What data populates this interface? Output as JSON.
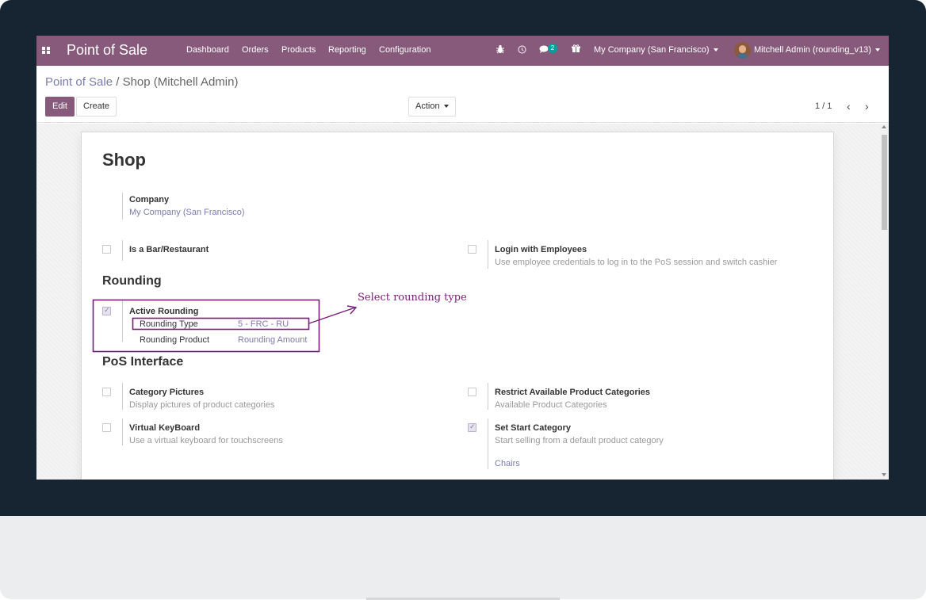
{
  "colors": {
    "brand": "#875a7b",
    "link": "#7c7bad",
    "annotation": "#7a1a7a",
    "badge": "#00a09d",
    "bezel": "#172431"
  },
  "navbar": {
    "app_name": "Point of Sale",
    "menu": [
      "Dashboard",
      "Orders",
      "Products",
      "Reporting",
      "Configuration"
    ],
    "icons": [
      "apps-icon",
      "bug-icon",
      "clock-icon",
      "chat-icon",
      "gift-icon"
    ],
    "messages_count": "2",
    "company": "My Company (San Francisco)",
    "user": "Mitchell Admin (rounding_v13)"
  },
  "breadcrumb": {
    "parent": "Point of Sale",
    "separator": "/",
    "current": "Shop (Mitchell Admin)"
  },
  "buttons": {
    "edit": "Edit",
    "create": "Create",
    "action": "Action"
  },
  "pager": {
    "value": "1 / 1"
  },
  "form": {
    "title": "Shop",
    "company_label": "Company",
    "company_value": "My Company (San Francisco)",
    "bar_restaurant": {
      "label": "Is a Bar/Restaurant",
      "checked": false
    },
    "login_employees": {
      "label": "Login with Employees",
      "help": "Use employee credentials to log in to the PoS session and switch cashier",
      "checked": false
    },
    "rounding_heading": "Rounding",
    "active_rounding": {
      "label": "Active Rounding",
      "checked": true
    },
    "rounding_type_label": "Rounding Type",
    "rounding_type_value": "5 - FRC - RU",
    "rounding_product_label": "Rounding Product",
    "rounding_product_value": "Rounding Amount",
    "pos_interface_heading": "PoS Interface",
    "category_pictures": {
      "label": "Category Pictures",
      "help": "Display pictures of product categories",
      "checked": false
    },
    "restrict_categories": {
      "label": "Restrict Available Product Categories",
      "help": "Available Product Categories",
      "checked": false
    },
    "virtual_keyboard": {
      "label": "Virtual KeyBoard",
      "help": "Use a virtual keyboard for touchscreens",
      "checked": false
    },
    "start_category": {
      "label": "Set Start Category",
      "help": "Start selling from a default product category",
      "value": "Chairs",
      "checked": true
    }
  },
  "annotation": {
    "text": "Select rounding type"
  }
}
